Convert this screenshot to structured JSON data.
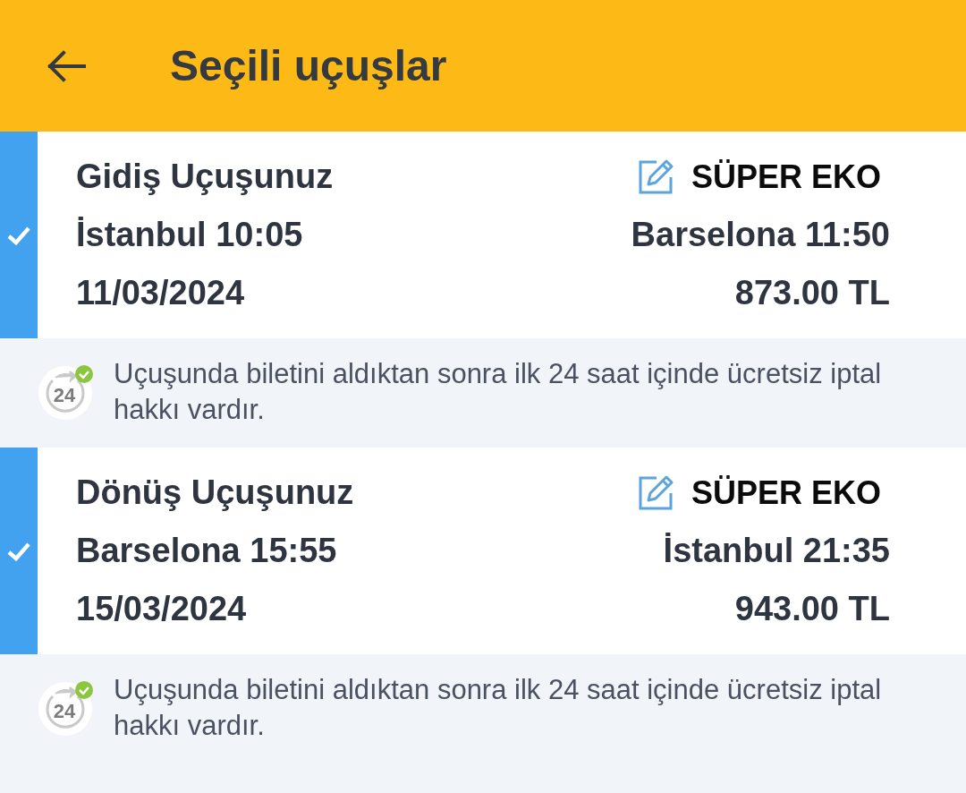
{
  "header": {
    "title": "Seçili uçuşlar"
  },
  "flights": [
    {
      "selected": true,
      "title": "Gidiş Uçuşunuz",
      "fare": "SÜPER EKO",
      "departure": "İstanbul 10:05",
      "arrival": "Barselona 11:50",
      "date": "11/03/2024",
      "price": "873.00 TL",
      "note": {
        "badge": "24",
        "text": "Uçuşunda biletini aldıktan sonra ilk 24 saat içinde ücretsiz iptal hakkı vardır."
      }
    },
    {
      "selected": true,
      "title": "Dönüş Uçuşunuz",
      "fare": "SÜPER EKO",
      "departure": "Barselona 15:55",
      "arrival": "İstanbul 21:35",
      "date": "15/03/2024",
      "price": "943.00 TL",
      "note": {
        "badge": "24",
        "text": "Uçuşunda biletini aldıktan sonra ilk 24 saat içinde ücretsiz iptal hakkı vardır."
      }
    }
  ]
}
